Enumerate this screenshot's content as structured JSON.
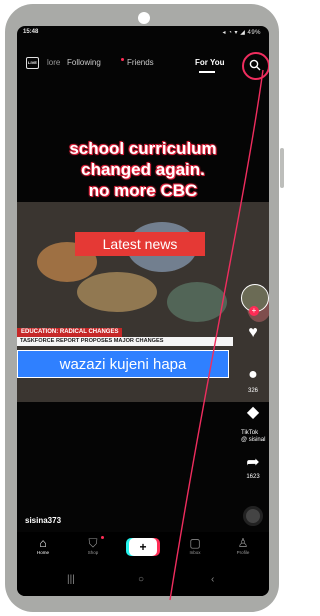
{
  "status_bar": {
    "time": "15:48",
    "icons_right": "◂ ◔ ▾ ◢ 49%"
  },
  "top_nav": {
    "live_label": "LIVE",
    "tabs": [
      "lore",
      "Following",
      "Friends",
      "For You"
    ]
  },
  "video": {
    "headline": [
      "school curriculum",
      "changed again.",
      "no more CBC"
    ],
    "news_banner": "Latest news",
    "ticker_label": "EDUCATION: RADICAL CHANGES",
    "ticker_text": "TASKFORCE REPORT PROPOSES MAJOR CHANGES",
    "caption": "wazazi kujeni hapa"
  },
  "right_rail": {
    "comment_count": "326",
    "share_count": "1623",
    "tiktok_mark": "TikTok",
    "tiktok_handle": "@ sisinal"
  },
  "username": "sisina373",
  "bottom_nav": {
    "home": "Home",
    "shop": "Shop",
    "inbox": "Inbox",
    "profile": "Profile"
  },
  "colors": {
    "accent": "#fe2c55",
    "annotation": "#ef2d5e",
    "caption_bg": "#2f80ff"
  },
  "icons": [
    "search-icon",
    "live-icon",
    "home-icon",
    "shop-icon",
    "create-icon",
    "inbox-icon",
    "profile-icon",
    "comment-icon",
    "share-icon",
    "like-icon"
  ]
}
